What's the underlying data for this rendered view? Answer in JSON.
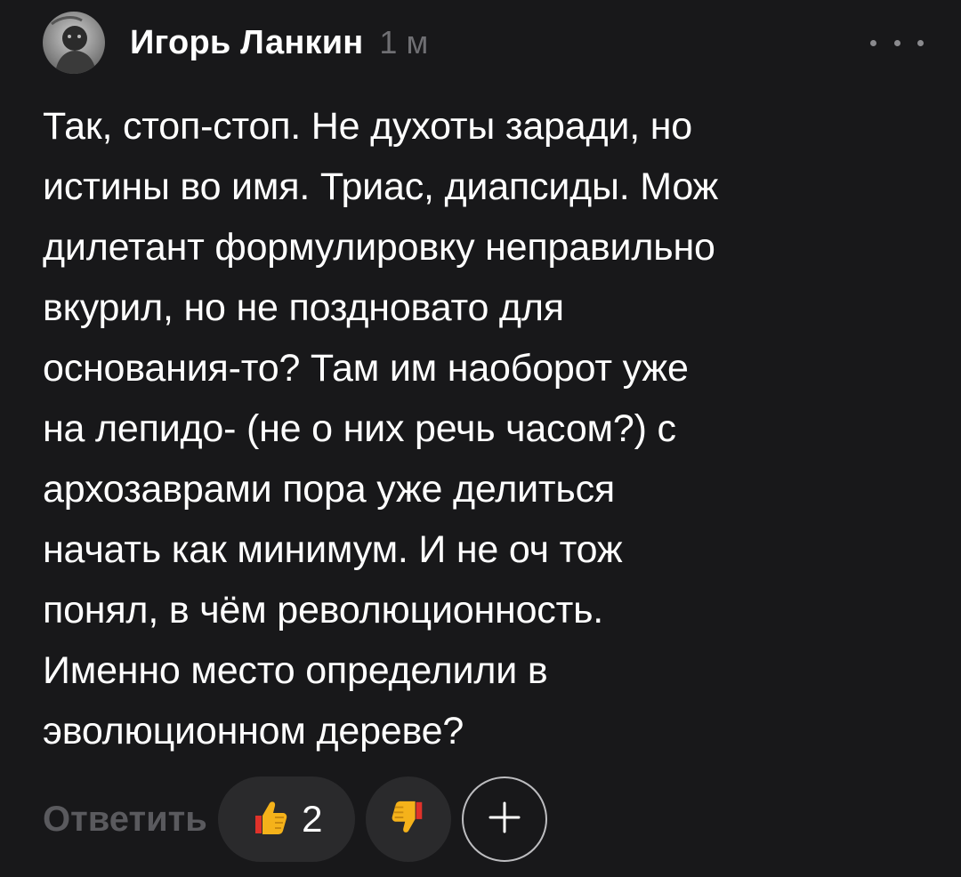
{
  "comment": {
    "author": "Игорь Ланкин",
    "time": "1 м",
    "text_lines": [
      "Так, стоп-стоп. Не духоты заради, но",
      "истины во имя. Триас, диапсиды. Мож",
      "дилетант формулировку неправильно",
      "вкурил, но не поздновато для",
      "основания-то? Там им наоборот уже",
      "на лепидо- (не о них речь часом?) с",
      "архозаврами пора уже делиться",
      "начать как минимум. И не оч тож",
      "понял, в чём революционность.",
      "Именно место определили в",
      "эволюционном дереве?"
    ]
  },
  "actions": {
    "reply_label": "Ответить",
    "like_count": "2",
    "like_icon": "thumbs-up-icon",
    "dislike_icon": "thumbs-down-icon",
    "add_icon": "plus-icon",
    "more_icon": "more-dots-icon"
  },
  "colors": {
    "background": "#18181a",
    "muted_text": "#6f6f73",
    "pill_bg": "#2a2a2c",
    "emoji_yellow": "#f5b21a",
    "emoji_red": "#e0322a"
  }
}
